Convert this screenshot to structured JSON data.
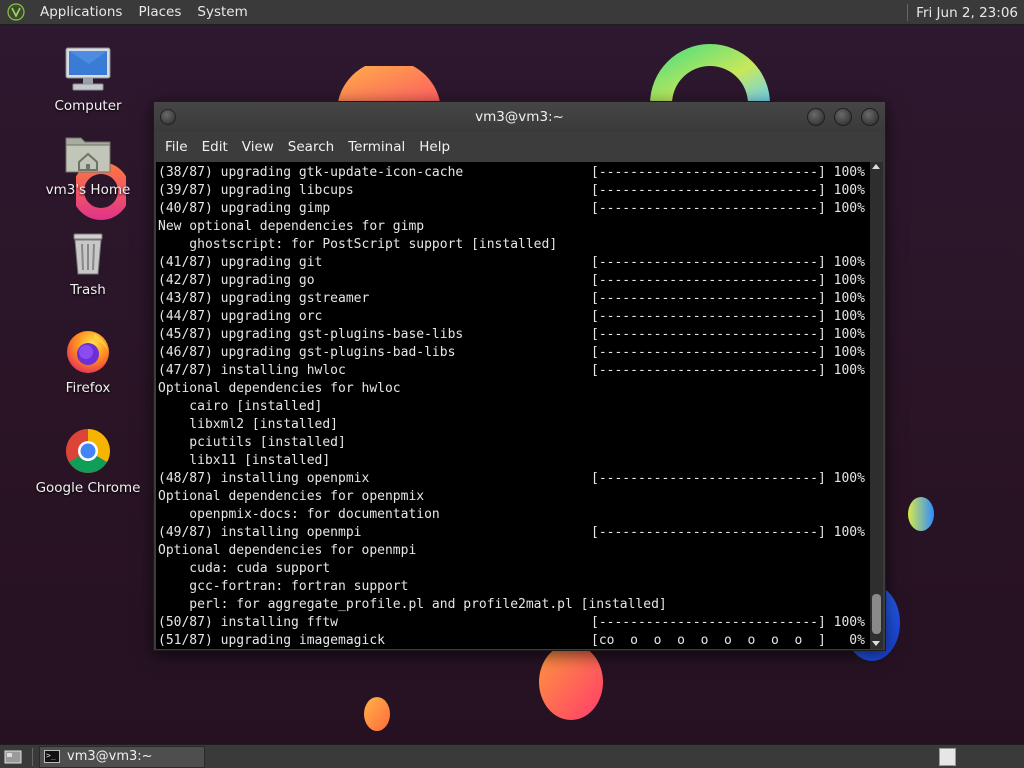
{
  "top_panel": {
    "menus": [
      "Applications",
      "Places",
      "System"
    ],
    "clock": "Fri Jun  2, 23:06"
  },
  "desktop_icons": [
    {
      "label": "Computer",
      "icon": "computer-icon"
    },
    {
      "label": "vm3's Home",
      "icon": "home-folder-icon"
    },
    {
      "label": "Trash",
      "icon": "trash-icon"
    },
    {
      "label": "Firefox",
      "icon": "firefox-icon"
    },
    {
      "label": "Google Chrome",
      "icon": "chrome-icon"
    }
  ],
  "terminal": {
    "title": "vm3@vm3:~",
    "menus": [
      "File",
      "Edit",
      "View",
      "Search",
      "Terminal",
      "Help"
    ],
    "lines": [
      {
        "text": "(38/87) upgrading gtk-update-icon-cache",
        "progress": "[----------------------------] 100%"
      },
      {
        "text": "(39/87) upgrading libcups",
        "progress": "[----------------------------] 100%"
      },
      {
        "text": "(40/87) upgrading gimp",
        "progress": "[----------------------------] 100%"
      },
      {
        "text": "New optional dependencies for gimp",
        "progress": ""
      },
      {
        "text": "    ghostscript: for PostScript support [installed]",
        "progress": ""
      },
      {
        "text": "(41/87) upgrading git",
        "progress": "[----------------------------] 100%"
      },
      {
        "text": "(42/87) upgrading go",
        "progress": "[----------------------------] 100%"
      },
      {
        "text": "(43/87) upgrading gstreamer",
        "progress": "[----------------------------] 100%"
      },
      {
        "text": "(44/87) upgrading orc",
        "progress": "[----------------------------] 100%"
      },
      {
        "text": "(45/87) upgrading gst-plugins-base-libs",
        "progress": "[----------------------------] 100%"
      },
      {
        "text": "(46/87) upgrading gst-plugins-bad-libs",
        "progress": "[----------------------------] 100%"
      },
      {
        "text": "(47/87) installing hwloc",
        "progress": "[----------------------------] 100%"
      },
      {
        "text": "Optional dependencies for hwloc",
        "progress": ""
      },
      {
        "text": "    cairo [installed]",
        "progress": ""
      },
      {
        "text": "    libxml2 [installed]",
        "progress": ""
      },
      {
        "text": "    pciutils [installed]",
        "progress": ""
      },
      {
        "text": "    libx11 [installed]",
        "progress": ""
      },
      {
        "text": "(48/87) installing openpmix",
        "progress": "[----------------------------] 100%"
      },
      {
        "text": "Optional dependencies for openpmix",
        "progress": ""
      },
      {
        "text": "    openpmix-docs: for documentation",
        "progress": ""
      },
      {
        "text": "(49/87) installing openmpi",
        "progress": "[----------------------------] 100%"
      },
      {
        "text": "Optional dependencies for openmpi",
        "progress": ""
      },
      {
        "text": "    cuda: cuda support",
        "progress": ""
      },
      {
        "text": "    gcc-fortran: fortran support",
        "progress": ""
      },
      {
        "text": "    perl: for aggregate_profile.pl and profile2mat.pl [installed]",
        "progress": ""
      },
      {
        "text": "(50/87) installing fftw",
        "progress": "[----------------------------] 100%"
      },
      {
        "text": "(51/87) upgrading imagemagick",
        "progress": "[co  o  o  o  o  o  o  o  o  ]   0%"
      }
    ]
  },
  "taskbar": {
    "task_label": "vm3@vm3:~"
  },
  "colors": {
    "panel": "#3a3a3a",
    "desktop": "#2a1426",
    "terminal_bg": "#000000",
    "terminal_fg": "#e6e6e6"
  }
}
